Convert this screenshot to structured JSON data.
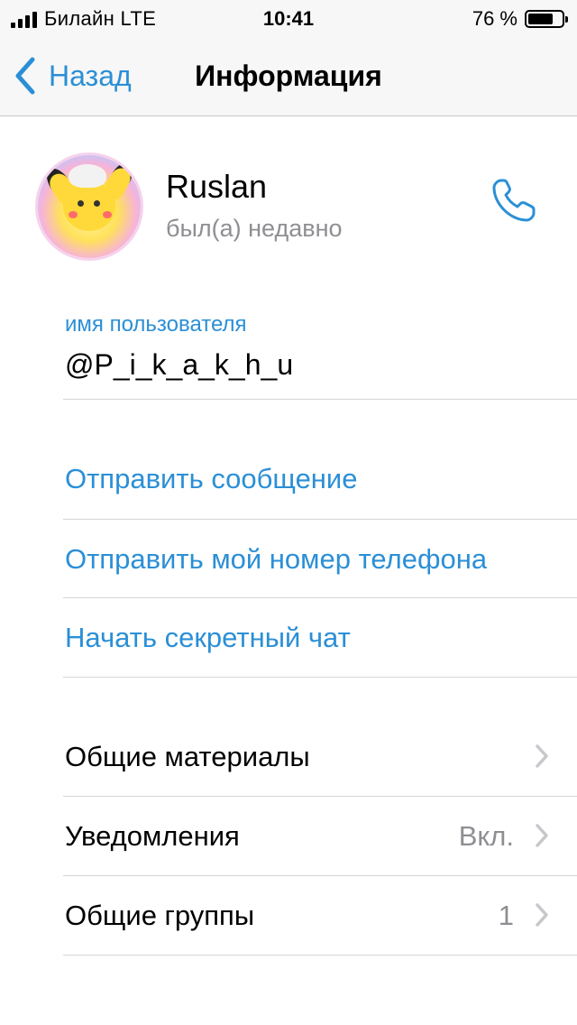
{
  "status_bar": {
    "carrier": "Билайн  LTE",
    "time": "10:41",
    "battery": "76 %",
    "battery_level": 0.76
  },
  "nav": {
    "back_label": "Назад",
    "title": "Информация"
  },
  "profile": {
    "name": "Ruslan",
    "status": "был(а) недавно"
  },
  "username": {
    "label": "имя пользователя",
    "value": "@P_i_k_a_k_h_u"
  },
  "actions": [
    {
      "label": "Отправить сообщение"
    },
    {
      "label": "Отправить мой номер телефона"
    },
    {
      "label": "Начать секретный чат"
    }
  ],
  "settings": [
    {
      "label": "Общие материалы",
      "value": ""
    },
    {
      "label": "Уведомления",
      "value": "Вкл."
    },
    {
      "label": "Общие группы",
      "value": "1"
    }
  ],
  "colors": {
    "accent": "#2b8fd6",
    "secondary_text": "#8e8e93",
    "danger": "#fe3b30"
  }
}
